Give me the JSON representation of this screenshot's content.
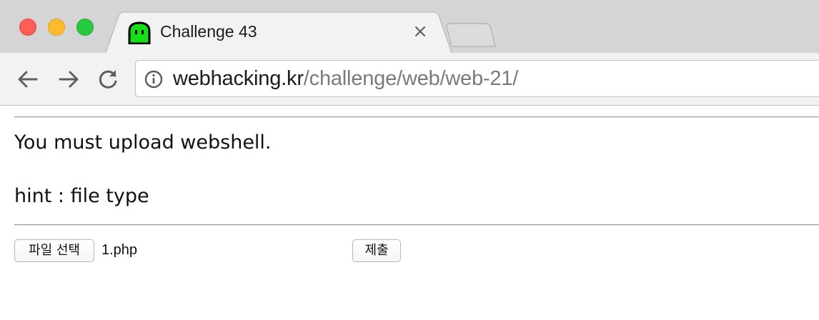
{
  "browser": {
    "tab": {
      "title": "Challenge 43",
      "favicon": "green-ghost-icon"
    },
    "omnibox": {
      "host": "webhacking.kr",
      "path": "/challenge/web/web-21/",
      "security_icon": "info-icon"
    },
    "nav": {
      "back_icon": "back-arrow-icon",
      "forward_icon": "forward-arrow-icon",
      "reload_icon": "reload-icon"
    },
    "colors": {
      "close": "#fd5e57",
      "minimize": "#fdbc2e",
      "maximize": "#28c840",
      "favicon": "#15e015"
    }
  },
  "page": {
    "message": "You must upload webshell.",
    "hint": "hint : file type",
    "form": {
      "file_button_label": "파일 선택",
      "file_name": "1.php",
      "submit_label": "제출"
    }
  }
}
